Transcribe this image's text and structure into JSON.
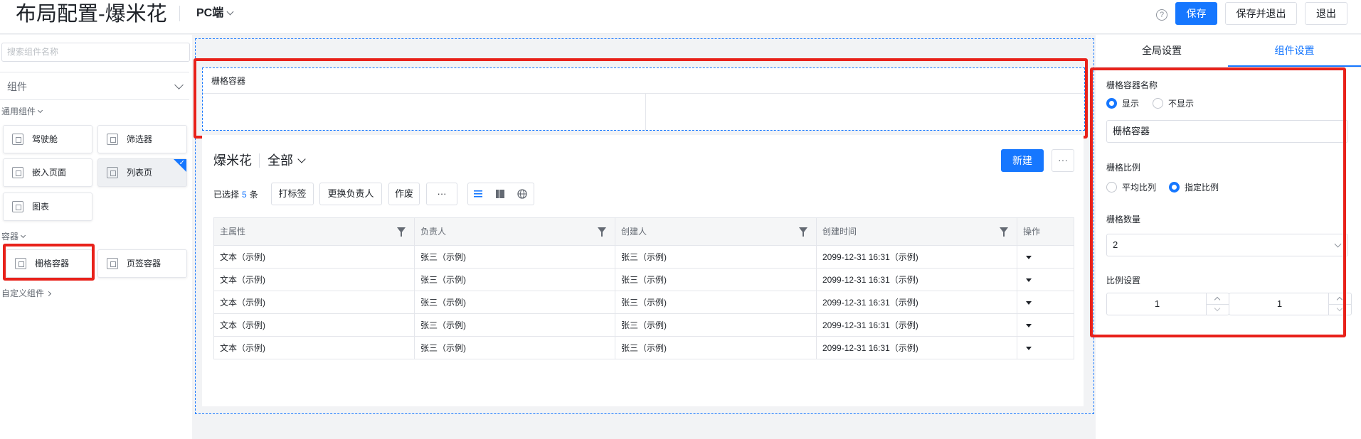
{
  "header": {
    "title": "布局配置-爆米花",
    "platform": "PC端",
    "help_icon": "?",
    "save": "保存",
    "save_exit": "保存并退出",
    "exit": "退出"
  },
  "left": {
    "search_placeholder": "搜索组件名称",
    "comp_select": "组件",
    "group_common": "通用组件",
    "common_items": [
      "驾驶舱",
      "筛选器",
      "嵌入页面",
      "列表页",
      "图表"
    ],
    "group_container": "容器",
    "container_items": [
      "栅格容器",
      "页签容器"
    ],
    "group_custom": "自定义组件"
  },
  "canvas": {
    "grid_title": "栅格容器",
    "list": {
      "title": "爆米花",
      "view": "全部",
      "new_label": "新建",
      "more_label": "···",
      "selected_prefix": "已选择",
      "selected_count": "5",
      "selected_suffix": "条",
      "actions": [
        "打标签",
        "更换负责人",
        "作废",
        "···"
      ],
      "columns": [
        "主属性",
        "负责人",
        "创建人",
        "创建时间",
        "操作"
      ],
      "rows": [
        [
          "文本（示例)",
          "张三（示例)",
          "张三（示例)",
          "2099-12-31 16:31（示例)"
        ],
        [
          "文本（示例)",
          "张三（示例)",
          "张三（示例)",
          "2099-12-31 16:31（示例)"
        ],
        [
          "文本（示例)",
          "张三（示例)",
          "张三（示例)",
          "2099-12-31 16:31（示例)"
        ],
        [
          "文本（示例)",
          "张三（示例)",
          "张三（示例)",
          "2099-12-31 16:31（示例)"
        ],
        [
          "文本（示例)",
          "张三（示例)",
          "张三（示例)",
          "2099-12-31 16:31（示例)"
        ]
      ]
    }
  },
  "right": {
    "tabs": [
      "全局设置",
      "组件设置"
    ],
    "name_label": "栅格容器名称",
    "show": "显示",
    "hide": "不显示",
    "name_value": "栅格容器",
    "ratio_label": "栅格比例",
    "ratio_avg": "平均比列",
    "ratio_custom": "指定比例",
    "count_label": "栅格数量",
    "count_value": "2",
    "ratio_setting_label": "比例设置",
    "ratio_values": [
      "1",
      "1"
    ]
  },
  "colors": {
    "accent": "#1677ff",
    "highlight": "#e8211a"
  }
}
